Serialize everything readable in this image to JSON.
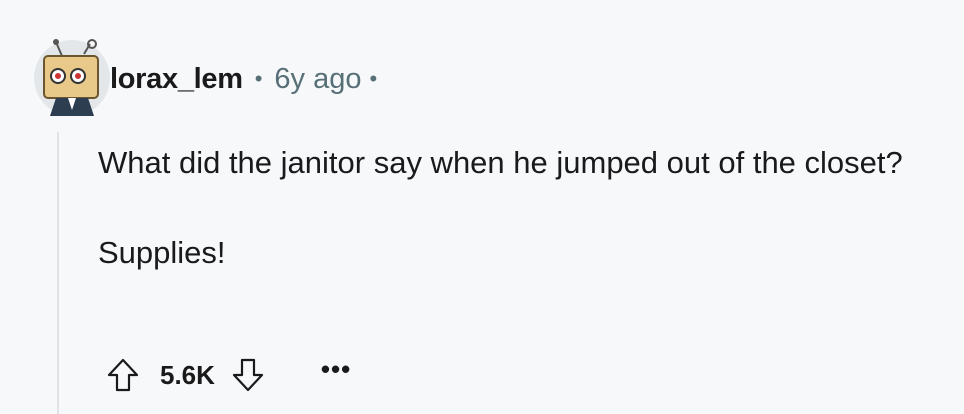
{
  "comment": {
    "author": "lorax_lem",
    "separator": "•",
    "age": "6y ago",
    "trailing_separator": "•",
    "paragraphs": [
      "What did the janitor say when he jumped out of the closet?",
      "Supplies!"
    ],
    "score": "5.6K",
    "more_label": "•••"
  },
  "icons": {
    "upvote": "arrow-up-outline-icon",
    "downvote": "arrow-down-outline-icon",
    "avatar": "robot-avatar"
  },
  "colors": {
    "background": "#f7f8fa",
    "text": "#1a1a1b",
    "meta": "#576f76",
    "thread_line": "#dfe3e6"
  }
}
